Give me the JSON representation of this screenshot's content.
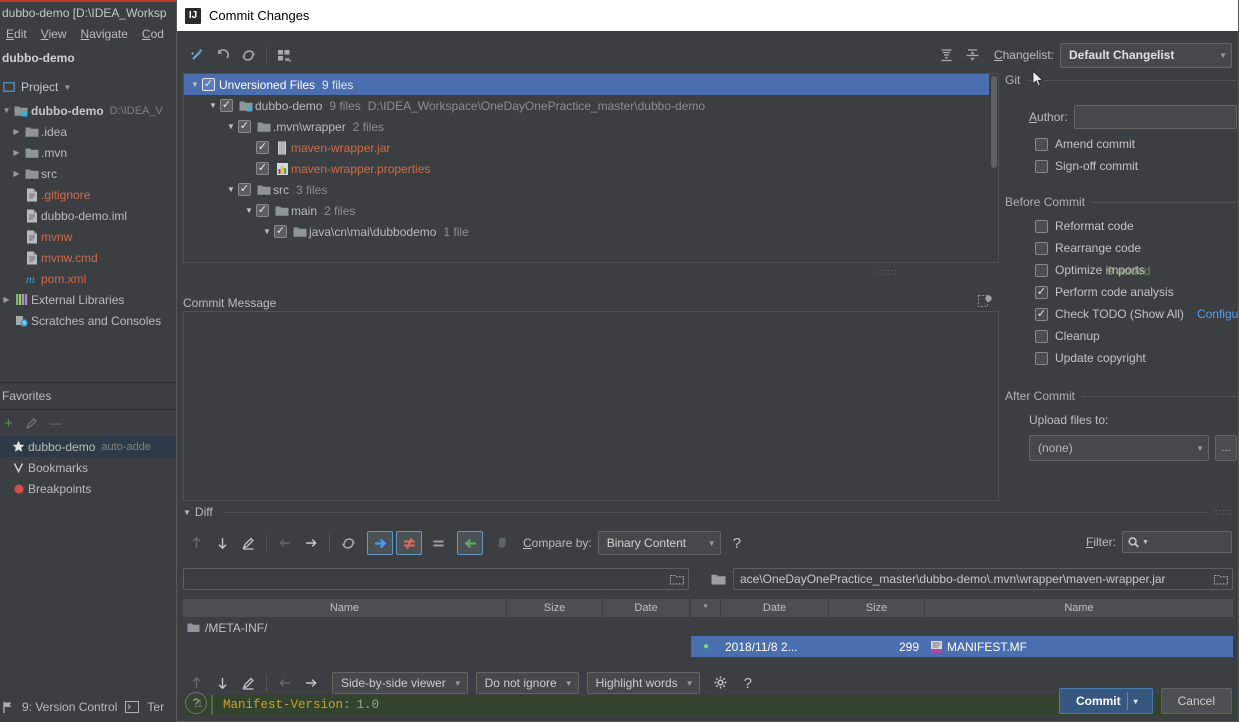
{
  "ide": {
    "title": "dubbo-demo [D:\\IDEA_Worksp",
    "menu": [
      "Edit",
      "View",
      "Navigate",
      "Cod"
    ],
    "breadcrumb": "dubbo-demo",
    "project_tool_label": "Project",
    "tree": [
      {
        "label": "dubbo-demo",
        "meta": "D:\\IDEA_V",
        "icon": "module-icon",
        "arrow": "▼",
        "bold": true,
        "color": "#c8c8c8"
      },
      {
        "label": ".idea",
        "meta": "",
        "icon": "folder-icon",
        "arrow": "▶",
        "bold": false,
        "color": "#bbbbbb"
      },
      {
        "label": ".mvn",
        "meta": "",
        "icon": "folder-icon",
        "arrow": "▶",
        "bold": false,
        "color": "#bbbbbb"
      },
      {
        "label": "src",
        "meta": "",
        "icon": "folder-icon",
        "arrow": "▶",
        "bold": false,
        "color": "#bbbbbb"
      },
      {
        "label": ".gitignore",
        "meta": "",
        "icon": "file-icon",
        "arrow": "",
        "bold": false,
        "color": "#cf6a4c"
      },
      {
        "label": "dubbo-demo.iml",
        "meta": "",
        "icon": "file-icon",
        "arrow": "",
        "bold": false,
        "color": "#bbbbbb"
      },
      {
        "label": "mvnw",
        "meta": "",
        "icon": "file-icon",
        "arrow": "",
        "bold": false,
        "color": "#cf6a4c"
      },
      {
        "label": "mvnw.cmd",
        "meta": "",
        "icon": "file-icon",
        "arrow": "",
        "bold": false,
        "color": "#cf6a4c"
      },
      {
        "label": "pom.xml",
        "meta": "",
        "icon": "maven-icon",
        "arrow": "",
        "bold": false,
        "color": "#cf6a4c"
      },
      {
        "label": "External Libraries",
        "meta": "",
        "icon": "libraries-icon",
        "arrow": "▶",
        "bold": false,
        "color": "#bbbbbb"
      },
      {
        "label": "Scratches and Consoles",
        "meta": "",
        "icon": "scratches-icon",
        "arrow": "",
        "bold": false,
        "color": "#bbbbbb"
      }
    ],
    "favorites_title": "Favorites",
    "favorites": [
      {
        "label": "dubbo-demo",
        "meta": "auto-adde",
        "icon": "star-icon",
        "selected": true
      },
      {
        "label": "Bookmarks",
        "meta": "",
        "icon": "bookmark-icon",
        "selected": false
      },
      {
        "label": "Breakpoints",
        "meta": "",
        "icon": "breakpoint-icon",
        "selected": false
      }
    ],
    "statusbar": {
      "version_control": "9: Version Control",
      "terminal": "Ter"
    }
  },
  "dialog": {
    "title": "Commit Changes",
    "toolbar": {
      "changelist_label": "Changelist:",
      "changelist_value": "Default Changelist",
      "icons": [
        "magic-wand-icon",
        "revert-icon",
        "refresh-icon",
        "group-by-icon",
        "expand-all-icon",
        "collapse-all-icon"
      ]
    },
    "tree": [
      {
        "depth": 0,
        "arrow": "▼",
        "checked": true,
        "icon": "",
        "name": "Unversioned Files",
        "meta": "9 files",
        "meta2": "",
        "selected": true,
        "name_color": ""
      },
      {
        "depth": 1,
        "arrow": "▼",
        "checked": true,
        "icon": "module-icon",
        "name": "dubbo-demo",
        "meta": "9 files",
        "meta2": "D:\\IDEA_Workspace\\OneDayOnePractice_master\\dubbo-demo",
        "selected": false,
        "name_color": ""
      },
      {
        "depth": 2,
        "arrow": "▼",
        "checked": true,
        "icon": "folder-icon",
        "name": ".mvn\\wrapper",
        "meta": "2 files",
        "meta2": "",
        "selected": false,
        "name_color": ""
      },
      {
        "depth": 3,
        "arrow": "",
        "checked": true,
        "icon": "jar-icon",
        "name": "maven-wrapper.jar",
        "meta": "",
        "meta2": "",
        "selected": false,
        "name_color": "#cf6a4c"
      },
      {
        "depth": 3,
        "arrow": "",
        "checked": true,
        "icon": "properties-icon",
        "name": "maven-wrapper.properties",
        "meta": "",
        "meta2": "",
        "selected": false,
        "name_color": "#cf6a4c"
      },
      {
        "depth": 2,
        "arrow": "▼",
        "checked": true,
        "icon": "folder-icon",
        "name": "src",
        "meta": "3 files",
        "meta2": "",
        "selected": false,
        "name_color": ""
      },
      {
        "depth": 3,
        "arrow": "▼",
        "checked": true,
        "icon": "folder-icon",
        "name": "main",
        "meta": "2 files",
        "meta2": "",
        "selected": false,
        "name_color": ""
      },
      {
        "depth": 4,
        "arrow": "▼",
        "checked": true,
        "icon": "folder-icon",
        "name": "java\\cn\\mai\\dubbodemo",
        "meta": "1 file",
        "meta2": "",
        "selected": false,
        "name_color": ""
      }
    ],
    "added_count": "9 added",
    "commit_message_label": "Commit Message",
    "commit_message_value": "",
    "diff": {
      "section_label": "Diff",
      "compare_by_label": "Compare by:",
      "compare_by_value": "Binary Content",
      "help_label": "?",
      "filter_label": "Filter:",
      "filter_value": "",
      "left_path": "",
      "right_path": "ace\\OneDayOnePractice_master\\dubbo-demo\\.mvn\\wrapper\\maven-wrapper.jar",
      "left_columns": [
        "Name",
        "Size",
        "Date"
      ],
      "right_columns": [
        "*",
        "Date",
        "Size",
        "Name"
      ],
      "left_rows": [
        {
          "name": "/META-INF/",
          "size": "",
          "date": "",
          "selected": false,
          "icon": "folder-icon"
        }
      ],
      "right_rows": [
        {
          "marker": "●",
          "date": "2018/11/8 2...",
          "size": "299",
          "name": "MANIFEST.MF",
          "selected": true,
          "icon": "manifest-icon"
        }
      ],
      "viewer_mode": "Side-by-side viewer",
      "ignore_mode": "Do not ignore",
      "highlight_mode": "Highlight words",
      "code_line_number": "1",
      "code_key": "Manifest-Version",
      "code_sep": ":",
      "code_value": "1.0"
    },
    "right_panel": {
      "git_section": "Git",
      "author_label": "Author:",
      "author_value": "",
      "git_checkboxes": [
        {
          "label": "Amend commit",
          "checked": false,
          "mnemonic": "A"
        },
        {
          "label": "Sign-off commit",
          "checked": false,
          "mnemonic": ""
        }
      ],
      "before_commit_section": "Before Commit",
      "before_commit_checkboxes": [
        {
          "label": "Reformat code",
          "checked": false
        },
        {
          "label": "Rearrange code",
          "checked": false
        },
        {
          "label": "Optimize imports",
          "checked": false
        },
        {
          "label": "Perform code analysis",
          "checked": true
        },
        {
          "label": "Check TODO (Show All)",
          "checked": true,
          "link": "Configur"
        },
        {
          "label": "Cleanup",
          "checked": false
        },
        {
          "label": "Update copyright",
          "checked": false
        }
      ],
      "after_commit_section": "After Commit",
      "upload_label": "Upload files to:",
      "upload_value": "(none)",
      "browse_label": "..."
    },
    "buttons": {
      "commit": "Commit",
      "commit_caret": "▾",
      "cancel": "Cancel",
      "help": "?"
    }
  },
  "colors": {
    "accent_blue": "#4b6eaf",
    "selection_blue": "#365880",
    "added_green": "#6a8759",
    "file_red": "#cf6a4c",
    "link_blue": "#589df6",
    "panel_bg": "#3c3f41"
  }
}
